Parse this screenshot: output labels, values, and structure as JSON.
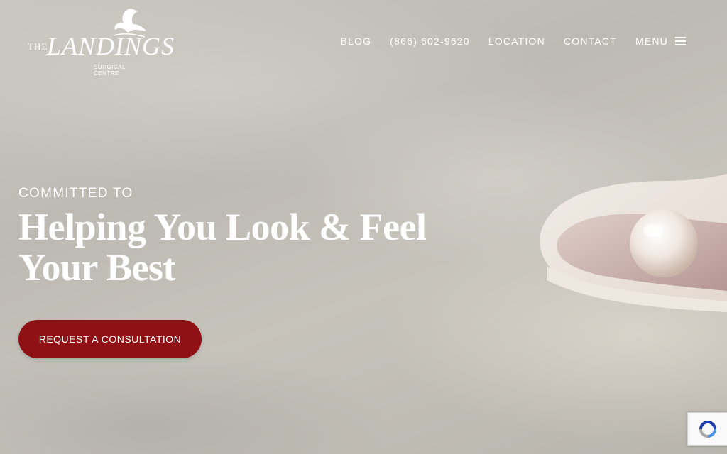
{
  "logo": {
    "the": "THE",
    "name": "LANDINGS",
    "subtitle": "SURGICAL CENTRE"
  },
  "nav": {
    "blog": "BLOG",
    "phone": "(866) 602-9620",
    "location": "LOCATION",
    "contact": "CONTACT",
    "menu": "MENU"
  },
  "hero": {
    "eyebrow": "COMMITTED TO",
    "headline_line1": "Helping You Look & Feel",
    "headline_line2": "Your Best",
    "cta_label": "REQUEST A CONSULTATION"
  },
  "colors": {
    "accent": "#8f1116",
    "text": "#ffffff"
  },
  "icons": {
    "menu": "hamburger-icon",
    "recaptcha": "recaptcha-icon"
  }
}
